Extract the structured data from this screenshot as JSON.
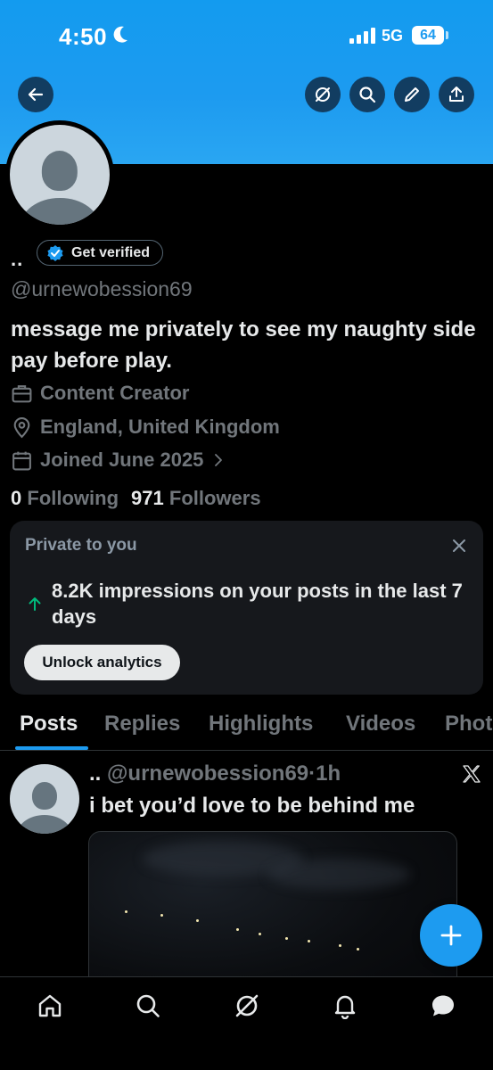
{
  "status_bar": {
    "time": "4:50",
    "network": "5G",
    "battery": "64"
  },
  "profile": {
    "display_name": "..",
    "verify_label": "Get verified",
    "handle": "@urnewobession69",
    "bio": "message me privately to see my naughty side pay before play.",
    "category": "Content Creator",
    "location": "England, United Kingdom",
    "joined": "Joined June 2025",
    "following_count": "0",
    "following_label": "Following",
    "followers_count": "971",
    "followers_label": "Followers"
  },
  "private_card": {
    "title": "Private to you",
    "impressions": "8.2K impressions on your posts in the last 7 days",
    "button": "Unlock analytics"
  },
  "tabs": [
    {
      "label": "Posts",
      "active": true
    },
    {
      "label": "Replies"
    },
    {
      "label": "Highlights"
    },
    {
      "label": "Videos"
    },
    {
      "label": "Photos"
    }
  ],
  "post": {
    "name": "..",
    "handle": "@urnewobession69",
    "time": "1h",
    "text": "i bet you’d love to be behind me"
  },
  "colors": {
    "accent": "#1d9bf0",
    "background": "#000000",
    "muted": "#71767b"
  },
  "icons": {
    "header": [
      "back-arrow-icon",
      "grok-icon",
      "search-icon",
      "edit-icon",
      "share-icon"
    ],
    "bottom_nav": [
      "home-icon",
      "search-icon",
      "grok-icon",
      "bell-icon",
      "messages-icon"
    ]
  }
}
